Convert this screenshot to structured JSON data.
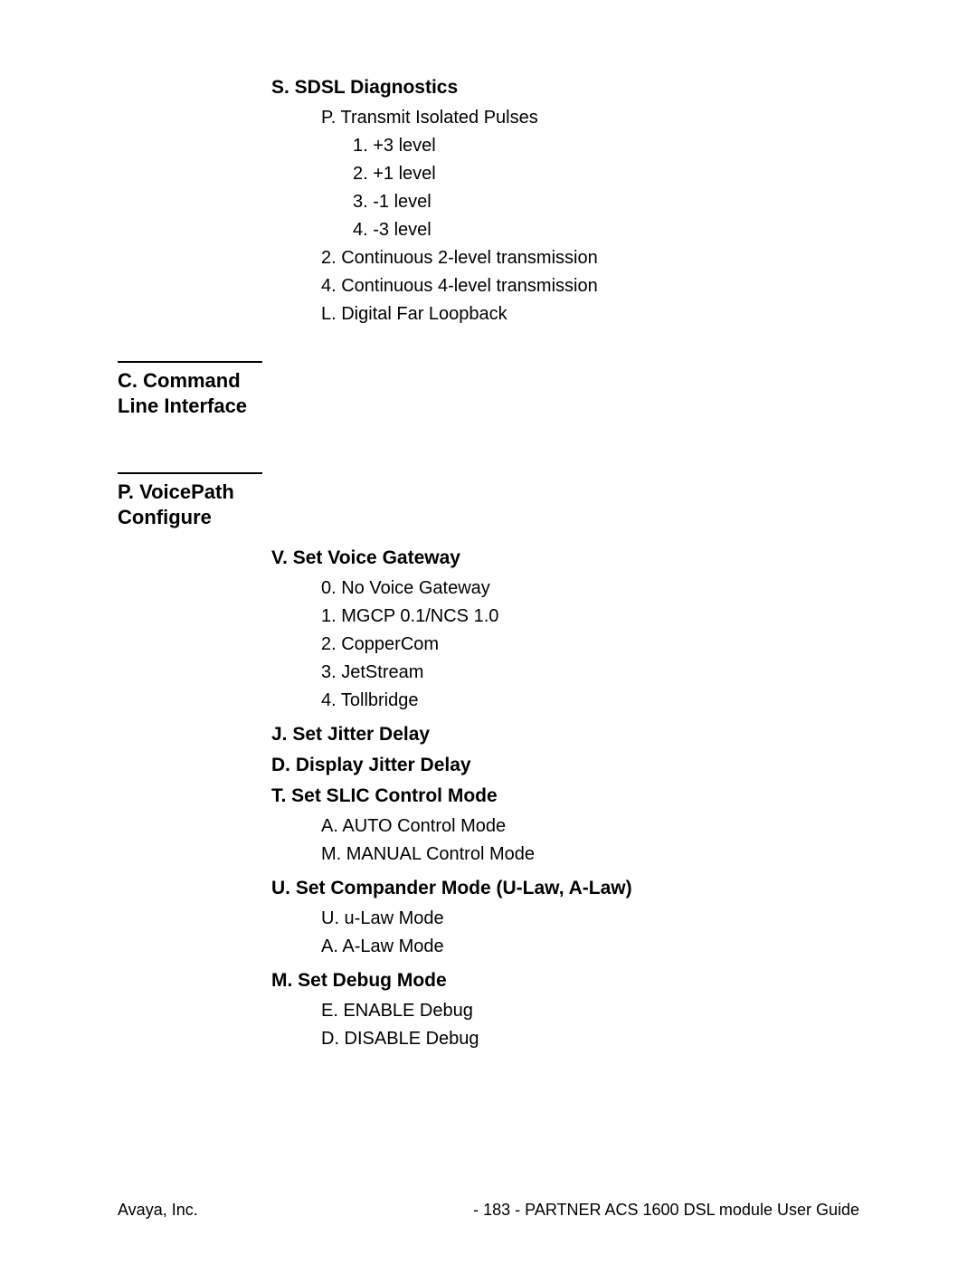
{
  "sections": {
    "sdsl": {
      "title": "S. SDSL Diagnostics",
      "items": [
        {
          "text": "P. Transmit Isolated Pulses",
          "level": 1
        },
        {
          "text": "1. +3 level",
          "level": 2
        },
        {
          "text": "2. +1 level",
          "level": 2
        },
        {
          "text": "3. -1 level",
          "level": 2
        },
        {
          "text": "4. -3 level",
          "level": 2
        },
        {
          "text": "2. Continuous 2-level transmission",
          "level": 1
        },
        {
          "text": "4. Continuous 4-level transmission",
          "level": 1
        },
        {
          "text": "L. Digital Far Loopback",
          "level": 1
        }
      ]
    },
    "cli": {
      "title": "C. Command Line Interface"
    },
    "voicepath": {
      "title": "P. VoicePath Configure",
      "groups": [
        {
          "title": "V. Set Voice Gateway",
          "items": [
            "0. No Voice Gateway",
            "1. MGCP 0.1/NCS 1.0",
            "2. CopperCom",
            "3. JetStream",
            "4. Tollbridge"
          ]
        },
        {
          "title": "J. Set Jitter Delay",
          "items": []
        },
        {
          "title": "D. Display Jitter Delay",
          "items": []
        },
        {
          "title": "T. Set SLIC Control Mode",
          "items": [
            "A. AUTO Control Mode",
            "M. MANUAL Control Mode"
          ]
        },
        {
          "title": "U. Set Compander Mode (U-Law, A-Law)",
          "items": [
            "U. u-Law Mode",
            "A. A-Law Mode"
          ]
        },
        {
          "title": "M. Set Debug Mode",
          "items": [
            "E. ENABLE Debug",
            "D. DISABLE Debug"
          ]
        }
      ]
    }
  },
  "footer": {
    "left": "Avaya, Inc.",
    "page": "- 183 -",
    "right": "PARTNER ACS 1600 DSL module User Guide"
  }
}
